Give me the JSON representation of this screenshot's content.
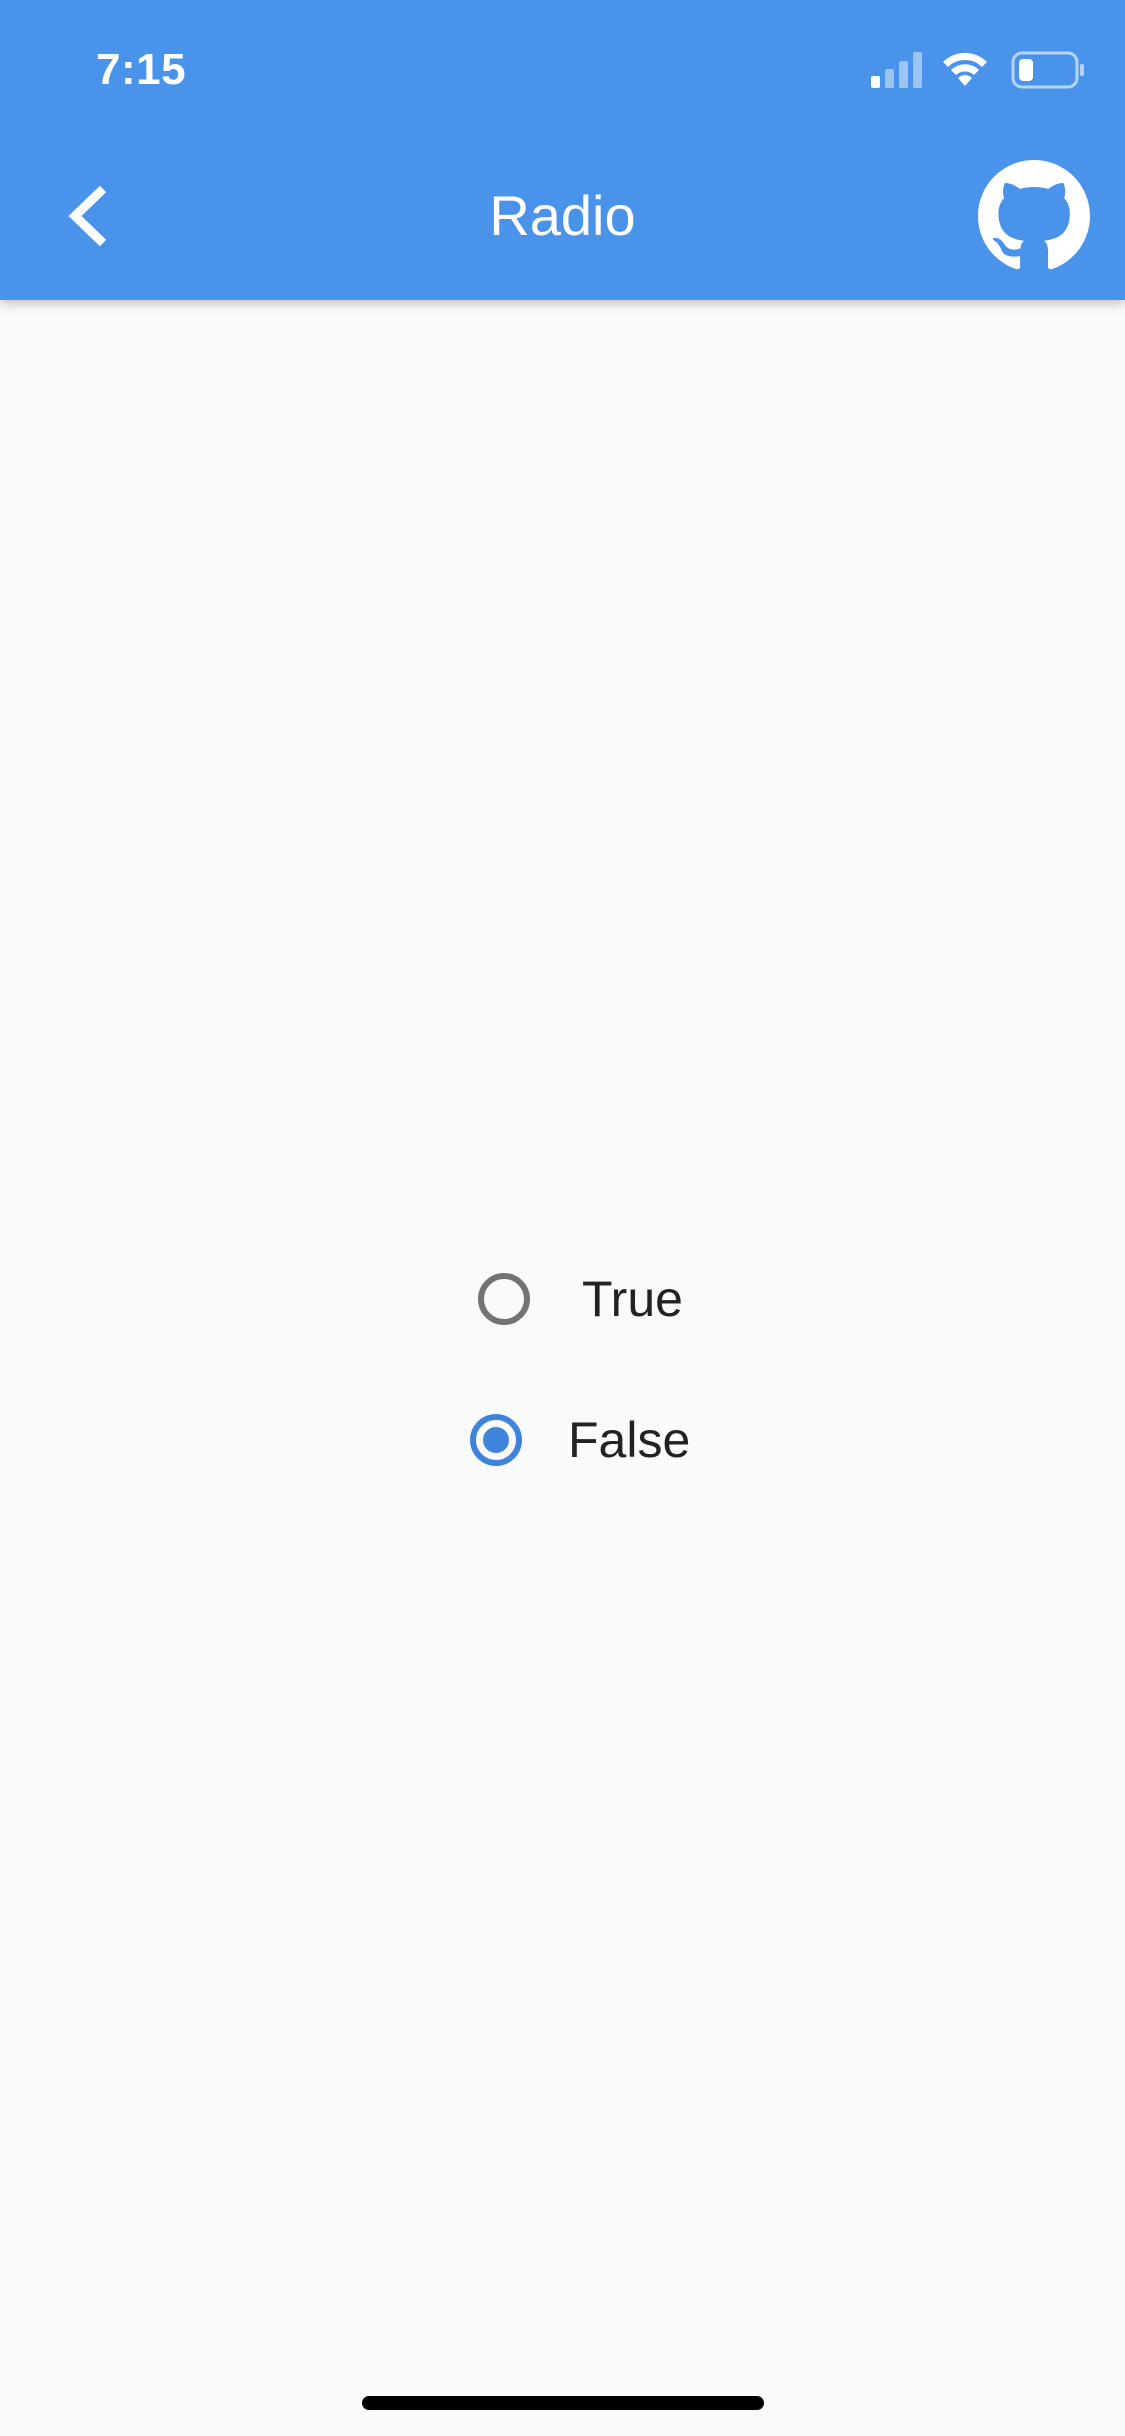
{
  "status_bar": {
    "time": "7:15"
  },
  "app_bar": {
    "title": "Radio",
    "back_icon": "chevron-left-icon",
    "action_icon": "github-icon",
    "color": "#4a93eb"
  },
  "radio_group": {
    "options": [
      {
        "label": "True",
        "selected": false
      },
      {
        "label": "False",
        "selected": true
      }
    ],
    "accent_color": "#3f84dc"
  }
}
